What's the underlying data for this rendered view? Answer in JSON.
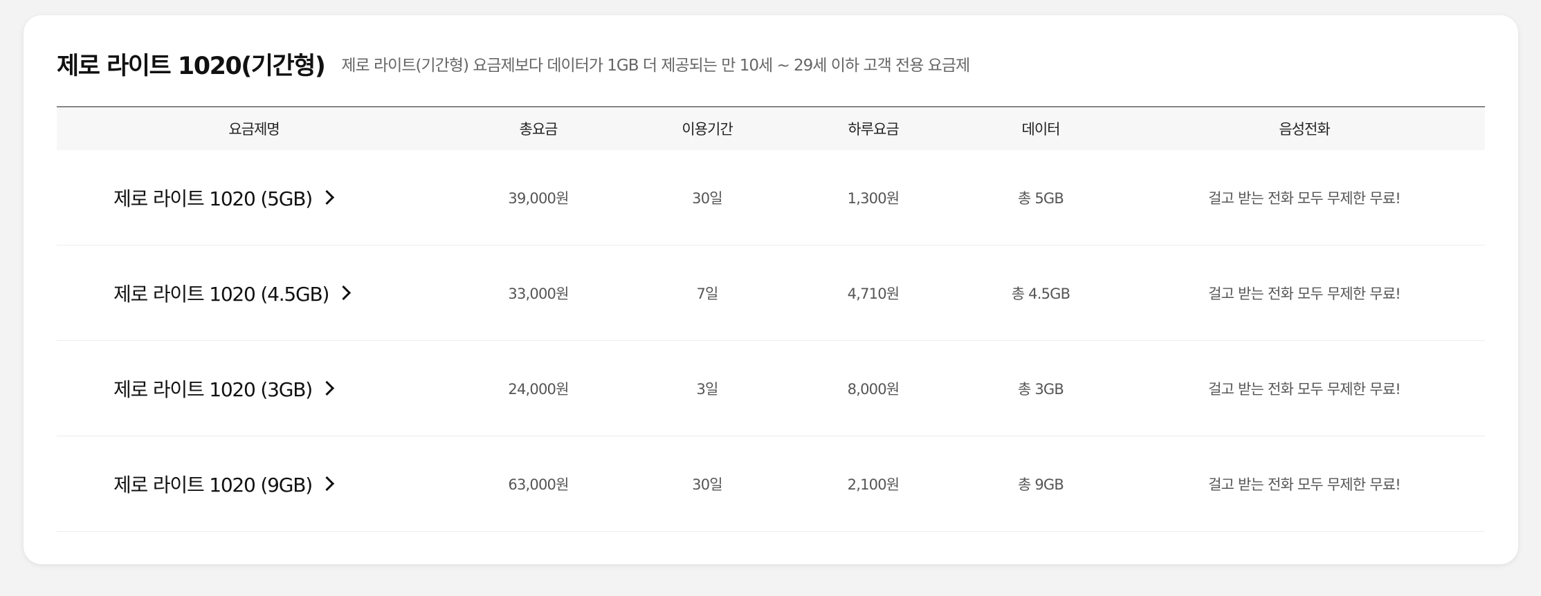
{
  "plan": {
    "title": "제로 라이트 1020(기간형)",
    "description": "제로 라이트(기간형) 요금제보다 데이터가 1GB 더 제공되는 만 10세 ~ 29세 이하 고객 전용 요금제"
  },
  "table": {
    "headers": {
      "name": "요금제명",
      "total": "총요금",
      "period": "이용기간",
      "daily": "하루요금",
      "data": "데이터",
      "voice": "음성전화"
    },
    "rows": [
      {
        "name": "제로 라이트 1020 (5GB)",
        "total": "39,000원",
        "period": "30일",
        "daily": "1,300원",
        "data": "총 5GB",
        "voice": "걸고 받는 전화 모두 무제한 무료!"
      },
      {
        "name": "제로 라이트 1020 (4.5GB)",
        "total": "33,000원",
        "period": "7일",
        "daily": "4,710원",
        "data": "총 4.5GB",
        "voice": "걸고 받는 전화 모두 무제한 무료!"
      },
      {
        "name": "제로 라이트 1020 (3GB)",
        "total": "24,000원",
        "period": "3일",
        "daily": "8,000원",
        "data": "총 3GB",
        "voice": "걸고 받는 전화 모두 무제한 무료!"
      },
      {
        "name": "제로 라이트 1020 (9GB)",
        "total": "63,000원",
        "period": "30일",
        "daily": "2,100원",
        "data": "총 9GB",
        "voice": "걸고 받는 전화 모두 무제한 무료!"
      }
    ]
  },
  "icons": {
    "row_link": "chevron-right-icon"
  },
  "colors": {
    "background": "#f3f3f3",
    "card": "#ffffff",
    "header_row": "#f7f7f7",
    "title_text": "#111111",
    "body_text": "#555555"
  }
}
